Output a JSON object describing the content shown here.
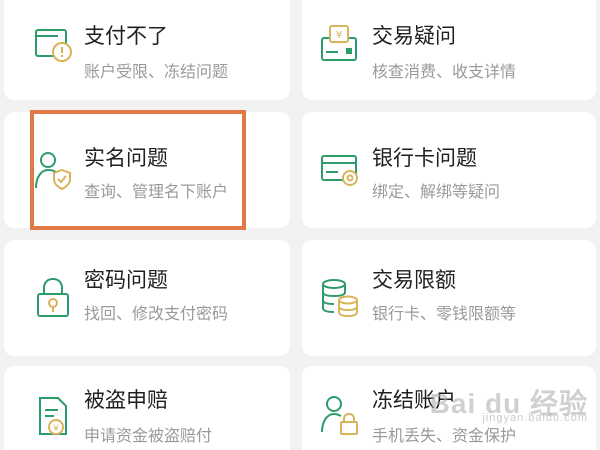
{
  "colors": {
    "icon_green": "#2e9b6a",
    "icon_gold": "#d9b35a",
    "highlight_border": "#e07945"
  },
  "items": [
    {
      "title": "支付不了",
      "subtitle": "账户受限、冻结问题",
      "icon": "wallet-alert-icon"
    },
    {
      "title": "交易疑问",
      "subtitle": "核查消费、收支详情",
      "icon": "transaction-question-icon"
    },
    {
      "title": "实名问题",
      "subtitle": "查询、管理名下账户",
      "icon": "user-shield-icon"
    },
    {
      "title": "银行卡问题",
      "subtitle": "绑定、解绑等疑问",
      "icon": "bank-card-gear-icon"
    },
    {
      "title": "密码问题",
      "subtitle": "找回、修改支付密码",
      "icon": "lock-key-icon"
    },
    {
      "title": "交易限额",
      "subtitle": "银行卡、零钱限额等",
      "icon": "coin-stack-icon"
    },
    {
      "title": "被盗申赔",
      "subtitle": "申请资金被盗赔付",
      "icon": "claim-document-icon"
    },
    {
      "title": "冻结账户",
      "subtitle": "手机丢失、资金保护",
      "icon": "user-lock-icon"
    }
  ],
  "watermark": {
    "text": "Bai du 经验",
    "url": "jingyan.baidu.com"
  }
}
